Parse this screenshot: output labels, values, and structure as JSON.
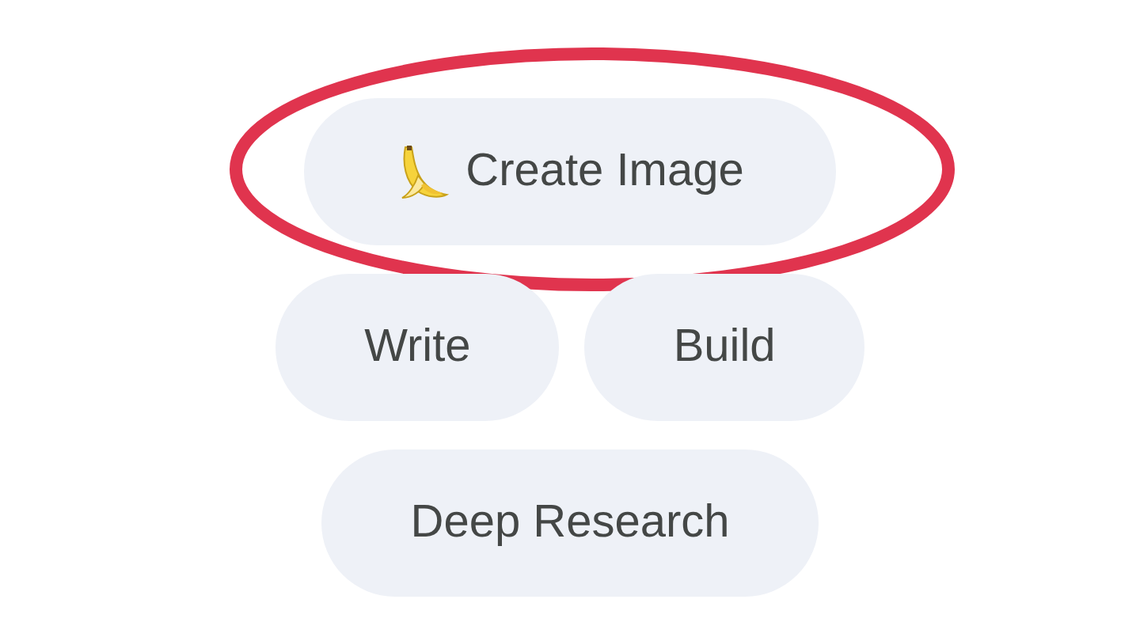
{
  "rows": [
    [
      {
        "label": "Create Image",
        "kind": "icon-chip",
        "highlighted": true
      }
    ],
    [
      {
        "label": "Write",
        "kind": "chip",
        "highlighted": false
      },
      {
        "label": "Build",
        "kind": "chip",
        "highlighted": false
      }
    ],
    [
      {
        "label": "Deep Research",
        "kind": "chip",
        "highlighted": false
      }
    ]
  ]
}
